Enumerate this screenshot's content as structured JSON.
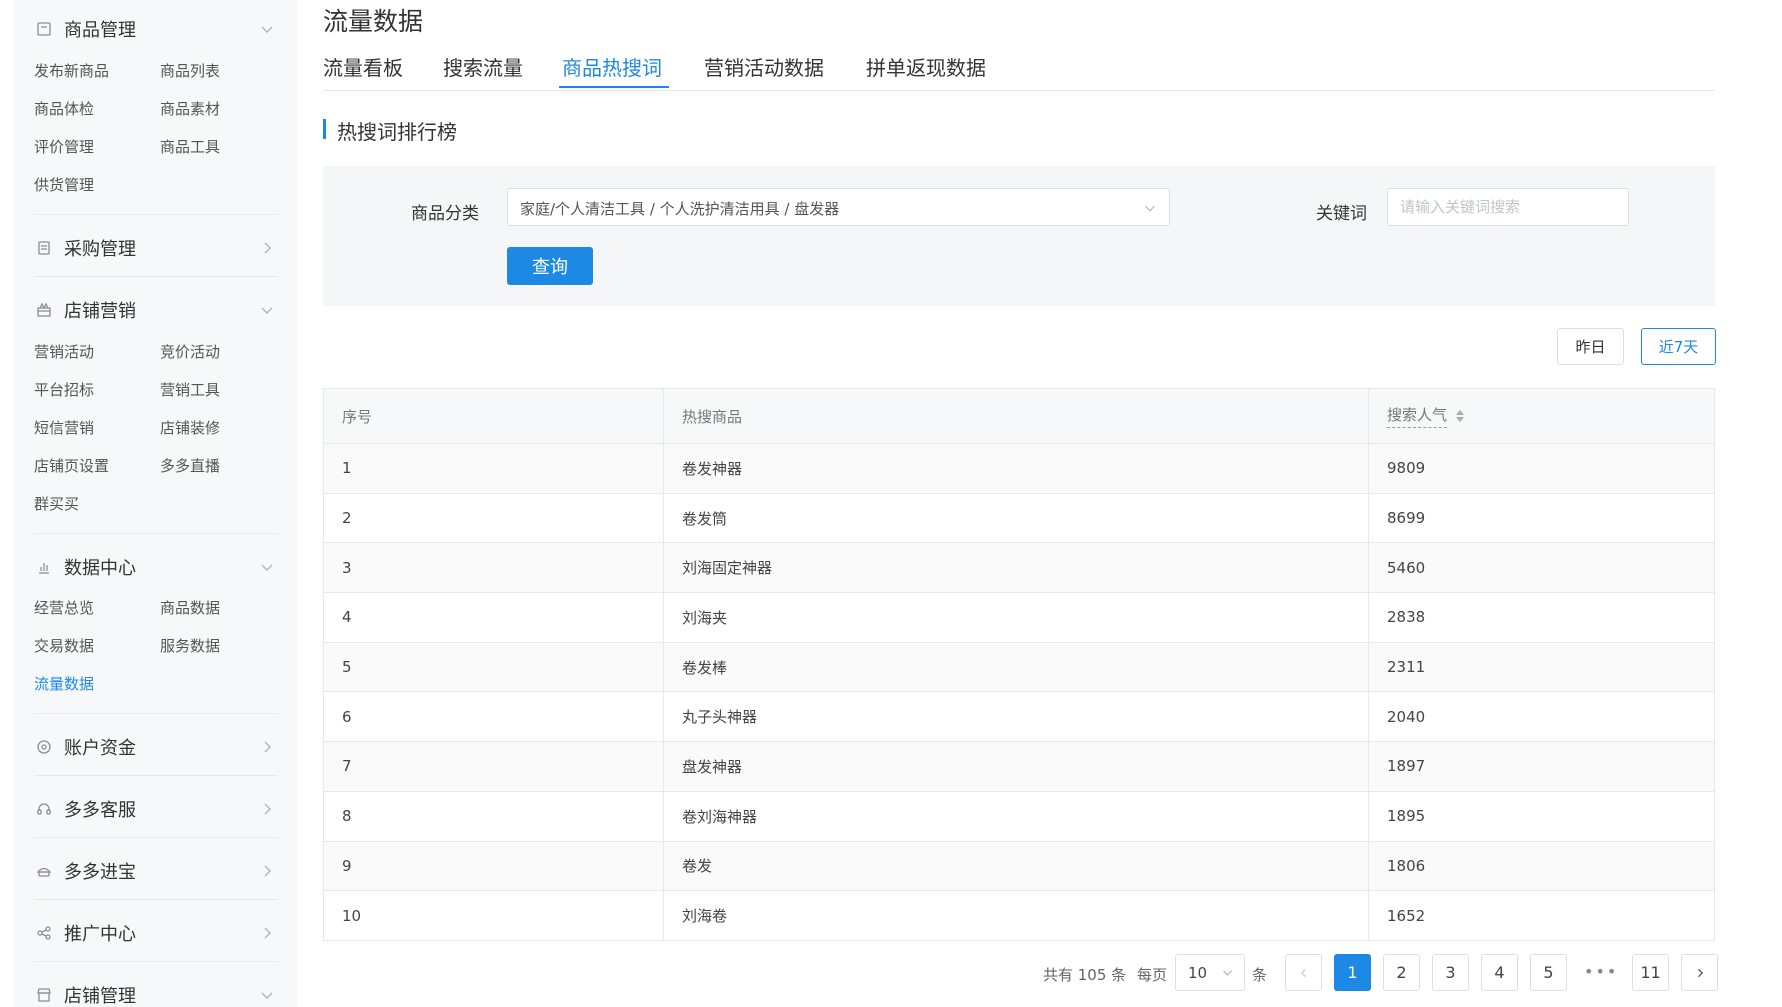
{
  "sidebar": {
    "goods": {
      "title": "商品管理",
      "icon": "box-icon",
      "items": [
        "发布新商品",
        "商品列表",
        "商品体检",
        "商品素材",
        "评价管理",
        "商品工具",
        "供货管理"
      ]
    },
    "purchase": {
      "title": "采购管理",
      "icon": "clipboard-icon"
    },
    "marketing": {
      "title": "店铺营销",
      "icon": "gift-icon",
      "items": [
        "营销活动",
        "竞价活动",
        "平台招标",
        "营销工具",
        "短信营销",
        "店铺装修",
        "店铺页设置",
        "多多直播",
        "群买买"
      ]
    },
    "data": {
      "title": "数据中心",
      "icon": "bar-chart-icon",
      "items": [
        "经营总览",
        "商品数据",
        "交易数据",
        "服务数据",
        "流量数据"
      ],
      "active": "流量数据"
    },
    "account": {
      "title": "账户资金",
      "icon": "coin-icon"
    },
    "service": {
      "title": "多多客服",
      "icon": "headset-icon"
    },
    "jinbao": {
      "title": "多多进宝",
      "icon": "treasure-icon"
    },
    "promo": {
      "title": "推广中心",
      "icon": "share-icon"
    },
    "shop": {
      "title": "店铺管理",
      "icon": "store-icon"
    }
  },
  "page": {
    "title": "流量数据"
  },
  "tabs": [
    "流量看板",
    "搜索流量",
    "商品热搜词",
    "营销活动数据",
    "拼单返现数据"
  ],
  "active_tab": "商品热搜词",
  "section": {
    "title": "热搜词排行榜"
  },
  "filter": {
    "category_label": "商品分类",
    "category_value": "家庭/个人清洁工具 / 个人洗护清洁用具 / 盘发器",
    "keyword_label": "关键词",
    "keyword_placeholder": "请输入关键词搜索",
    "query_button": "查询"
  },
  "range": {
    "yesterday": "昨日",
    "last7": "近7天",
    "active": "近7天"
  },
  "table": {
    "headers": {
      "index": "序号",
      "product": "热搜商品",
      "popularity": "搜索人气"
    },
    "rows": [
      {
        "index": "1",
        "product": "卷发神器",
        "popularity": "9809"
      },
      {
        "index": "2",
        "product": "卷发筒",
        "popularity": "8699"
      },
      {
        "index": "3",
        "product": "刘海固定神器",
        "popularity": "5460"
      },
      {
        "index": "4",
        "product": "刘海夹",
        "popularity": "2838"
      },
      {
        "index": "5",
        "product": "卷发棒",
        "popularity": "2311"
      },
      {
        "index": "6",
        "product": "丸子头神器",
        "popularity": "2040"
      },
      {
        "index": "7",
        "product": "盘发神器",
        "popularity": "1897"
      },
      {
        "index": "8",
        "product": "卷刘海神器",
        "popularity": "1895"
      },
      {
        "index": "9",
        "product": "卷发",
        "popularity": "1806"
      },
      {
        "index": "10",
        "product": "刘海卷",
        "popularity": "1652"
      }
    ]
  },
  "pagination": {
    "total_text": "共有 105 条",
    "per_page_label": "每页",
    "per_page_value": "10",
    "unit": "条",
    "pages": [
      "1",
      "2",
      "3",
      "4",
      "5"
    ],
    "last_page": "11",
    "current": "1",
    "ellipsis": "•••"
  },
  "colors": {
    "accent": "#1e88e5"
  }
}
